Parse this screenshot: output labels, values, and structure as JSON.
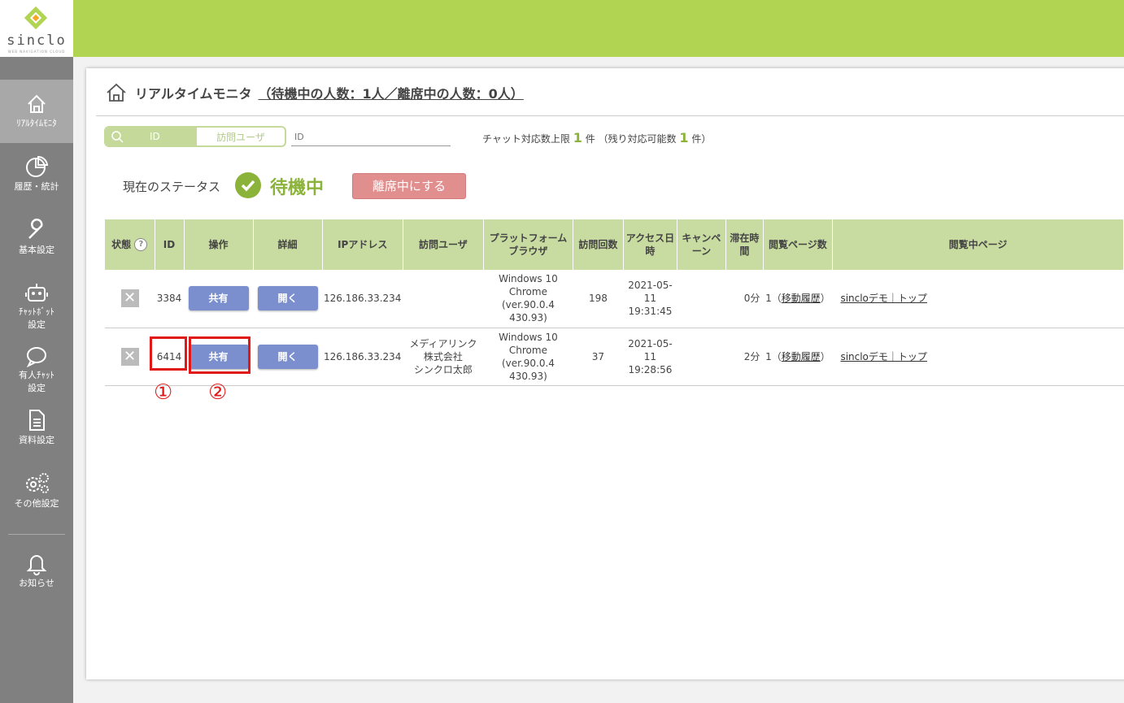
{
  "sidebar": {
    "logo_word": "sinclo",
    "logo_tag": "WEB NAVIGATION CLOUD",
    "items": [
      {
        "label": "ﾘｱﾙﾀｲﾑﾓﾆﾀ",
        "icon": "home-icon"
      },
      {
        "label": "履歴・統計",
        "icon": "pie-chart-icon"
      },
      {
        "label": "基本設定",
        "icon": "wrench-icon"
      },
      {
        "label": "ﾁｬｯﾄﾎﾞｯﾄ\n設定",
        "icon": "robot-icon"
      },
      {
        "label": "有人ﾁｬｯﾄ\n設定",
        "icon": "chat-bubble-icon"
      },
      {
        "label": "資料設定",
        "icon": "document-icon"
      },
      {
        "label": "その他設定",
        "icon": "gears-icon"
      },
      {
        "label": "お知らせ",
        "icon": "bell-icon"
      }
    ]
  },
  "header": {
    "title": "リアルタイムモニタ",
    "counts": "（待機中の人数：1人／離席中の人数：0人）"
  },
  "search": {
    "toggle_id": "ID",
    "toggle_user": "訪問ユーザ",
    "placeholder": "ID"
  },
  "chat_limit": {
    "prefix": "チャット対応数上限",
    "limit": "1",
    "unit1": "件 （残り対応可能数",
    "remaining": "1",
    "unit2": "件）"
  },
  "status": {
    "label": "現在のステータス",
    "value": "待機中",
    "away_button": "離席中にする"
  },
  "table": {
    "headers": {
      "state": "状態",
      "id": "ID",
      "operation": "操作",
      "detail": "詳細",
      "ip": "IPアドレス",
      "user": "訪問ユーザ",
      "platform": "プラットフォーム\nブラウザ",
      "visits": "訪問回数",
      "access": "アクセス日時",
      "campaign": "キャンペーン",
      "stay": "滞在時間",
      "pages": "閲覧ページ数",
      "current": "閲覧中ページ"
    },
    "rows": [
      {
        "id": "3384",
        "share": "共有",
        "open": "開く",
        "ip": "126.186.33.234",
        "user": "",
        "platform": "Windows 10\nChrome (ver.90.0.4\n430.93)",
        "visits": "198",
        "access": "2021-05-11\n19:31:45",
        "campaign": "",
        "stay": "0分",
        "pages": "1（",
        "history": "移動履歴",
        "pages_end": "）",
        "page": "sincloデモ｜トップ"
      },
      {
        "id": "6414",
        "share": "共有",
        "open": "開く",
        "ip": "126.186.33.234",
        "user": "メディアリンク\n株式会社\nシンクロ太郎",
        "platform": "Windows 10\nChrome (ver.90.0.4\n430.93)",
        "visits": "37",
        "access": "2021-05-11\n19:28:56",
        "campaign": "",
        "stay": "2分",
        "pages": "1（",
        "history": "移動履歴",
        "pages_end": "）",
        "page": "sincloデモ｜トップ"
      }
    ]
  },
  "annotations": {
    "one": "①",
    "two": "②",
    "color": "#e01818"
  },
  "colors": {
    "accent": "#b2d453",
    "button": "#7b8fcf",
    "away": "#e08e8e",
    "status": "#8bb33a"
  }
}
